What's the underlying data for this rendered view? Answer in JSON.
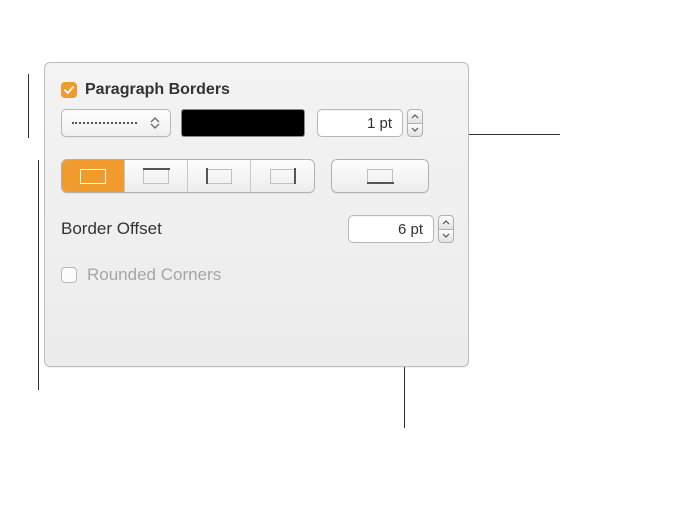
{
  "section": {
    "title": "Paragraph Borders",
    "enabled": true
  },
  "lineStyle": {
    "value": "dotted"
  },
  "weight": {
    "value": "1 pt"
  },
  "positions": {
    "options": [
      "all",
      "top",
      "left",
      "right"
    ],
    "outside": "bottom",
    "selected": "all"
  },
  "offset": {
    "label": "Border Offset",
    "value": "6 pt"
  },
  "roundedCorners": {
    "label": "Rounded Corners",
    "enabled": false
  }
}
